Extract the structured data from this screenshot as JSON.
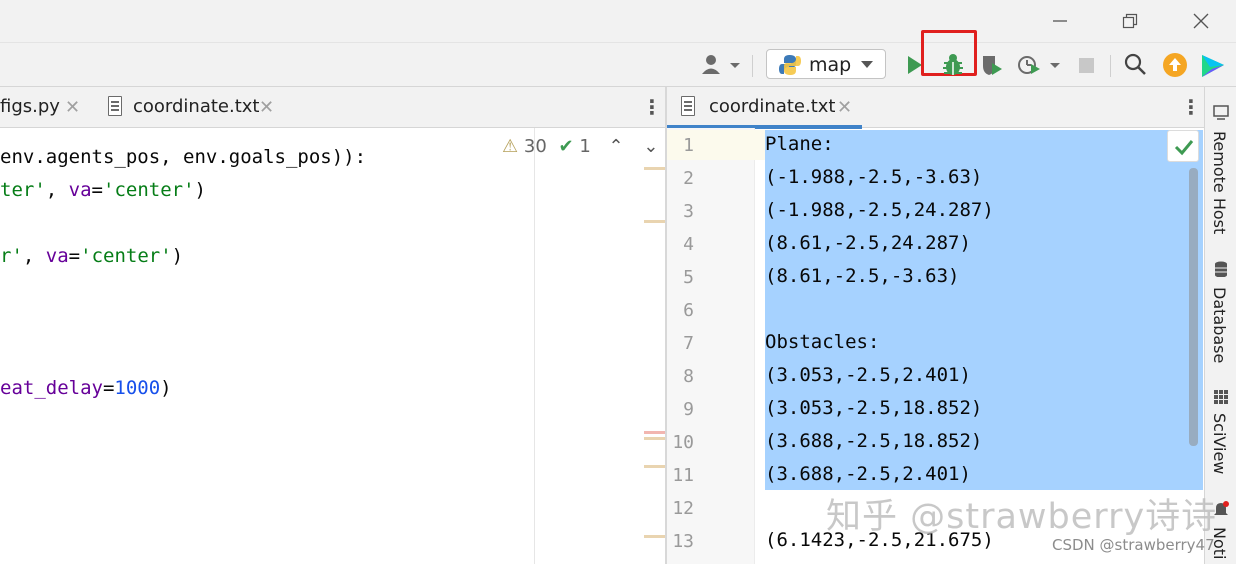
{
  "toolbar": {
    "run_config": "map",
    "highlight_color": "#e0201e"
  },
  "left_tabs": [
    {
      "label": "figs.py"
    },
    {
      "label": "coordinate.txt"
    }
  ],
  "inspections": {
    "warnings": "30",
    "weak_warnings": "1"
  },
  "left_code": [
    {
      "segments": [
        {
          "t": "env.agents_pos, env.goals_pos)):",
          "c": "plain"
        }
      ]
    },
    {
      "segments": [
        {
          "t": "ter'",
          "c": "str"
        },
        {
          "t": ", ",
          "c": "plain"
        },
        {
          "t": "va",
          "c": "param"
        },
        {
          "t": "=",
          "c": "plain"
        },
        {
          "t": "'center'",
          "c": "str"
        },
        {
          "t": ")",
          "c": "plain"
        }
      ]
    },
    {
      "segments": []
    },
    {
      "segments": [
        {
          "t": "r'",
          "c": "str"
        },
        {
          "t": ", ",
          "c": "plain"
        },
        {
          "t": "va",
          "c": "param"
        },
        {
          "t": "=",
          "c": "plain"
        },
        {
          "t": "'center'",
          "c": "str"
        },
        {
          "t": ")",
          "c": "plain"
        }
      ]
    },
    {
      "segments": []
    },
    {
      "segments": []
    },
    {
      "segments": []
    },
    {
      "segments": [
        {
          "t": "eat_delay",
          "c": "param"
        },
        {
          "t": "=",
          "c": "plain"
        },
        {
          "t": "1000",
          "c": "num"
        },
        {
          "t": ")",
          "c": "plain"
        }
      ]
    }
  ],
  "right_tab": {
    "label": "coordinate.txt"
  },
  "right_lines": [
    {
      "n": "1",
      "text": "Plane:"
    },
    {
      "n": "2",
      "text": "(-1.988,-2.5,-3.63)"
    },
    {
      "n": "3",
      "text": "(-1.988,-2.5,24.287)"
    },
    {
      "n": "4",
      "text": "(8.61,-2.5,24.287)"
    },
    {
      "n": "5",
      "text": "(8.61,-2.5,-3.63)"
    },
    {
      "n": "6",
      "text": ""
    },
    {
      "n": "7",
      "text": "Obstacles:"
    },
    {
      "n": "8",
      "text": "(3.053,-2.5,2.401)"
    },
    {
      "n": "9",
      "text": "(3.053,-2.5,18.852)"
    },
    {
      "n": "10",
      "text": "(3.688,-2.5,18.852)"
    },
    {
      "n": "11",
      "text": "(3.688,-2.5,2.401)"
    },
    {
      "n": "12",
      "text": ""
    },
    {
      "n": "13",
      "text": "(6.1423,-2.5,21.675)"
    }
  ],
  "tool_windows": {
    "remote_host": "Remote Host",
    "database": "Database",
    "sciview": "SciView",
    "notifications": "Noti"
  },
  "watermarks": {
    "zhihu": "知乎 @strawberry诗诗",
    "csdn": "CSDN @strawberry47"
  },
  "colors": {
    "selection": "#a6d2ff",
    "string": "#067d17",
    "number": "#1750eb",
    "param": "#660099"
  }
}
